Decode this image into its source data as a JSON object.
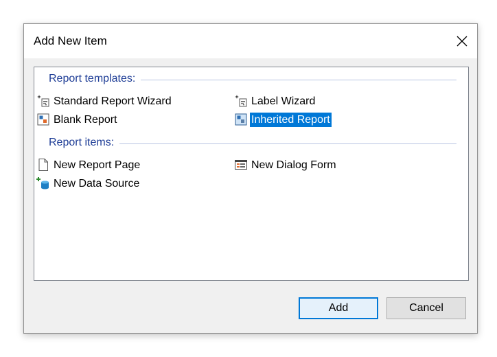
{
  "dialog": {
    "title": "Add New Item"
  },
  "groups": {
    "templates": {
      "header": "Report templates:",
      "items": [
        {
          "label": "Standard Report Wizard",
          "icon": "wizard-icon"
        },
        {
          "label": "Label Wizard",
          "icon": "wizard-icon"
        },
        {
          "label": "Blank Report",
          "icon": "report-icon"
        },
        {
          "label": "Inherited Report",
          "icon": "report-icon",
          "selected": true
        }
      ]
    },
    "report_items": {
      "header": "Report items:",
      "items": [
        {
          "label": "New Report Page",
          "icon": "page-icon"
        },
        {
          "label": "New Dialog Form",
          "icon": "dialog-form-icon"
        },
        {
          "label": "New Data Source",
          "icon": "add-data-source-icon"
        }
      ]
    }
  },
  "buttons": {
    "add": "Add",
    "cancel": "Cancel"
  },
  "colors": {
    "selection": "#0078d7",
    "group_header": "#1e3d96"
  }
}
